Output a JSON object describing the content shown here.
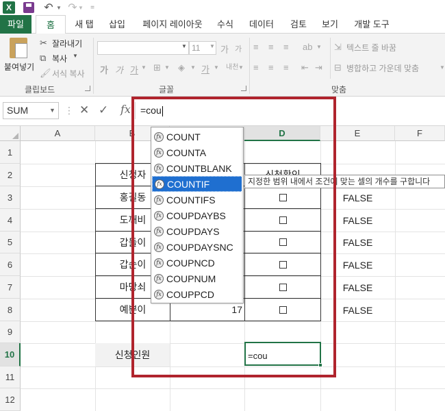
{
  "quick_access": {
    "excel_logo": "X",
    "save_icon": "save-icon",
    "undo_icon": "↶",
    "redo_icon": "↷",
    "more": "="
  },
  "tabs": [
    "파일",
    "홈",
    "새 탭",
    "삽입",
    "페이지 레이아웃",
    "수식",
    "데이터",
    "검토",
    "보기",
    "개발 도구"
  ],
  "ribbon": {
    "clipboard": {
      "paste": "붙여넣기",
      "cut": "잘라내기",
      "copy": "복사",
      "format_painter": "서식 복사",
      "label": "클립보드"
    },
    "font": {
      "size": "11",
      "bold": "가",
      "italic": "가",
      "underline": "가",
      "grow": "가",
      "shrink": "가",
      "label": "글꼴"
    },
    "alignment": {
      "wrap": "텍스트 줄 바꿈",
      "merge": "병합하고 가운데 맞춤",
      "label": "맞춤"
    }
  },
  "formula_bar": {
    "name_box": "SUM",
    "formula": "=cou",
    "fx": "fx"
  },
  "columns": [
    "A",
    "B",
    "C",
    "D",
    "E",
    "F"
  ],
  "rows": [
    "1",
    "2",
    "3",
    "4",
    "5",
    "6",
    "7",
    "8",
    "9",
    "10",
    "11",
    "12"
  ],
  "cells": {
    "b2": "신청자",
    "d2": "신청확인",
    "b_names": [
      "홍길동",
      "도깨비",
      "갑돌이",
      "갑순이",
      "마당쇠",
      "예쁜이"
    ],
    "c8": "17",
    "e_values": [
      "FALSE",
      "FALSE",
      "FALSE",
      "FALSE",
      "FALSE",
      "FALSE"
    ],
    "b10": "신청인원",
    "d10": "=cou"
  },
  "autocomplete": {
    "items": [
      "COUNT",
      "COUNTA",
      "COUNTBLANK",
      "COUNTIF",
      "COUNTIFS",
      "COUPDAYBS",
      "COUPDAYS",
      "COUPDAYSNC",
      "COUPNCD",
      "COUPNUM",
      "COUPPCD"
    ],
    "selected_index": 3,
    "tooltip": "지정한 범위 내에서 조건에 맞는 셀의 개수를 구합니다"
  },
  "colors": {
    "excel_green": "#217346",
    "highlight_red": "#b0242d",
    "selection_blue": "#1f6fd0"
  }
}
